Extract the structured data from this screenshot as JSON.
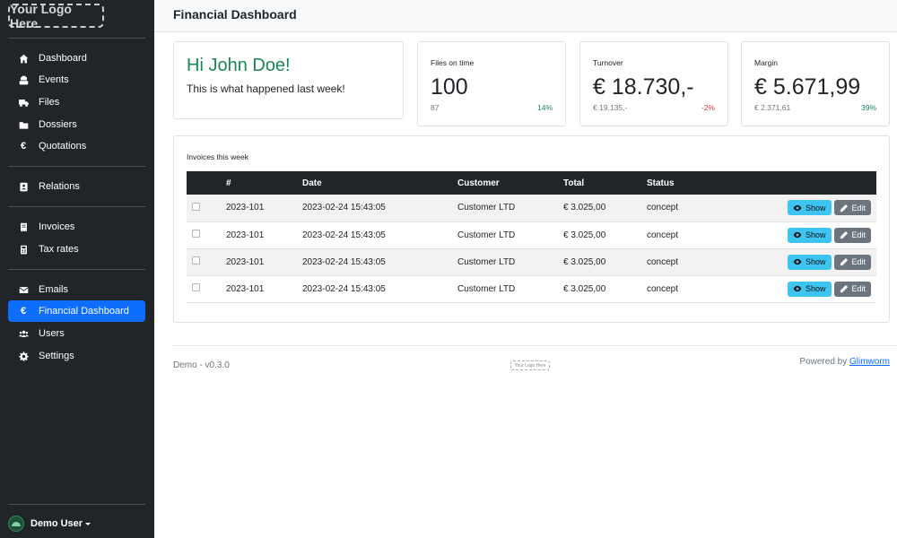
{
  "sidebar": {
    "logo": "Your Logo Here",
    "items": [
      {
        "label": "Dashboard",
        "icon": "home-icon"
      },
      {
        "label": "Events",
        "icon": "cash-register-icon"
      },
      {
        "label": "Files",
        "icon": "truck-icon"
      },
      {
        "label": "Dossiers",
        "icon": "folder-icon"
      },
      {
        "label": "Quotations",
        "icon": "euro-icon"
      },
      {
        "label": "Relations",
        "icon": "address-book-icon"
      },
      {
        "label": "Invoices",
        "icon": "receipt-icon"
      },
      {
        "label": "Tax rates",
        "icon": "calculator-icon"
      },
      {
        "label": "Emails",
        "icon": "envelope-icon"
      },
      {
        "label": "Financial Dashboard",
        "icon": "euro-icon",
        "active": true
      },
      {
        "label": "Users",
        "icon": "users-icon"
      },
      {
        "label": "Settings",
        "icon": "gear-icon"
      }
    ],
    "user": "Demo User"
  },
  "header": {
    "title": "Financial Dashboard"
  },
  "welcome": {
    "greeting": "Hi John Doe!",
    "text": "This is what happened last week!"
  },
  "kpis": [
    {
      "label": "Files on time",
      "value": "100",
      "previous": "87",
      "change": "14%",
      "trend": "positive"
    },
    {
      "label": "Turnover",
      "value": "€ 18.730,-",
      "previous": "€ 19.135,-",
      "change": "-2%",
      "trend": "negative"
    },
    {
      "label": "Margin",
      "value": "€ 5.671,99",
      "previous": "€ 2.371,61",
      "change": "39%",
      "trend": "positive"
    }
  ],
  "invoices": {
    "title": "Invoices this week",
    "columns": [
      "#",
      "Date",
      "Customer",
      "Total",
      "Status"
    ],
    "rows": [
      {
        "number": "2023-101",
        "date": "2023-02-24 15:43:05",
        "customer": "Customer LTD",
        "total": "€ 3.025,00",
        "status": "concept"
      },
      {
        "number": "2023-101",
        "date": "2023-02-24 15:43:05",
        "customer": "Customer LTD",
        "total": "€ 3.025,00",
        "status": "concept"
      },
      {
        "number": "2023-101",
        "date": "2023-02-24 15:43:05",
        "customer": "Customer LTD",
        "total": "€ 3.025,00",
        "status": "concept"
      },
      {
        "number": "2023-101",
        "date": "2023-02-24 15:43:05",
        "customer": "Customer LTD",
        "total": "€ 3.025,00",
        "status": "concept"
      }
    ],
    "show_label": "Show",
    "edit_label": "Edit"
  },
  "footer": {
    "version": "Demo - v0.3.0",
    "logo": "Your Logo Here",
    "powered_prefix": "Powered by",
    "powered_link": "Glimworm"
  },
  "colors": {
    "sidebar_bg": "#212529",
    "accent": "#0d6efd",
    "positive": "#198754",
    "negative": "#dc3545",
    "show_button": "#3dc4f0",
    "edit_button": "#6c757d"
  }
}
